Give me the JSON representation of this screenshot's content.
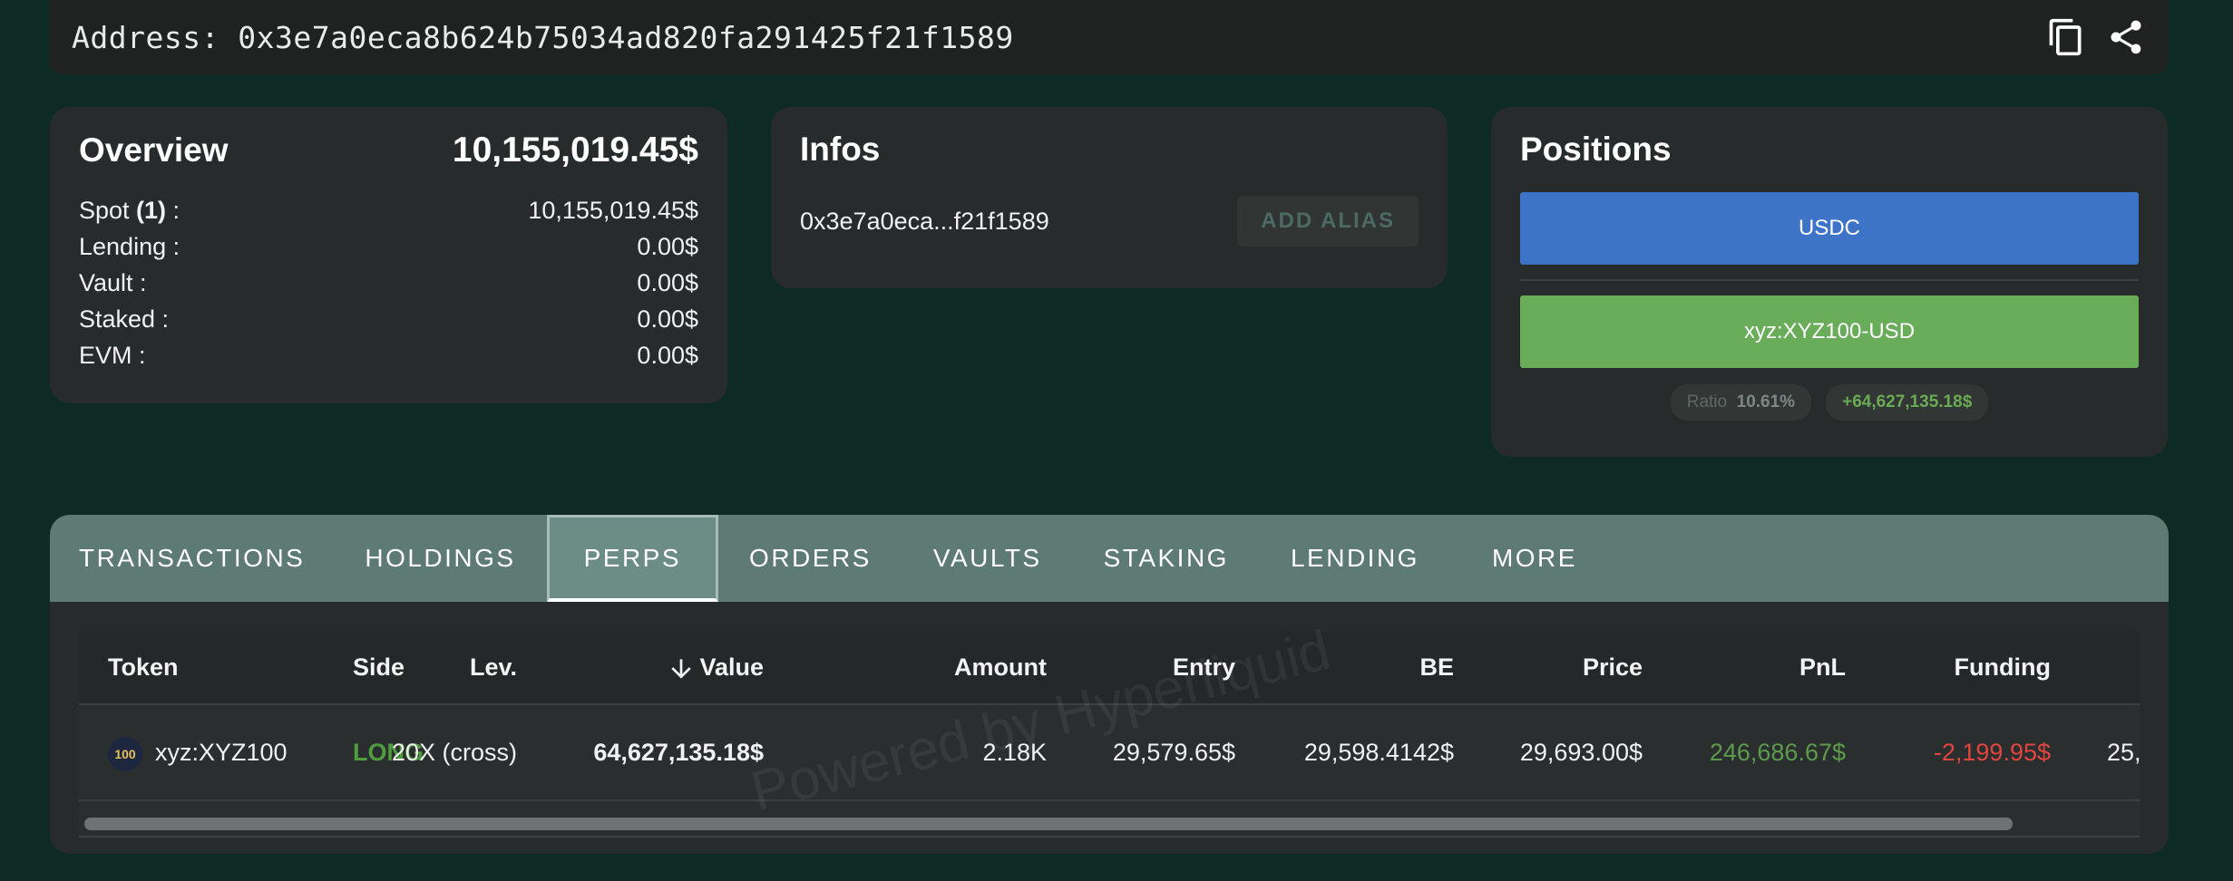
{
  "address_bar": {
    "text": "Address: 0x3e7a0eca8b624b75034ad820fa291425f21f1589",
    "copy_icon": "copy-icon",
    "share_icon": "share-icon"
  },
  "overview": {
    "title": "Overview",
    "total": "10,155,019.45$",
    "rows": [
      {
        "label": "Spot ",
        "count": "(1)",
        "suffix": " :",
        "value": "10,155,019.45$"
      },
      {
        "label": "Lending :",
        "value": "0.00$"
      },
      {
        "label": "Vault :",
        "value": "0.00$"
      },
      {
        "label": "Staked :",
        "value": "0.00$"
      },
      {
        "label": "EVM :",
        "value": "0.00$"
      }
    ]
  },
  "infos": {
    "title": "Infos",
    "short_address": "0x3e7a0eca...f21f1589",
    "alias_button": "ADD ALIAS"
  },
  "positions": {
    "title": "Positions",
    "bars": [
      "USDC",
      "xyz:XYZ100-USD"
    ],
    "ratio_label": "Ratio",
    "ratio_value": "10.61%",
    "pnl_chip": "+64,627,135.18$",
    "colors": {
      "usdc": "#3d74c8",
      "xyz": "#69ad5b"
    }
  },
  "tabs": [
    "TRANSACTIONS",
    "HOLDINGS",
    "PERPS",
    "ORDERS",
    "VAULTS",
    "STAKING",
    "LENDING",
    "MORE"
  ],
  "active_tab": "PERPS",
  "table": {
    "headers": [
      "Token",
      "Side",
      "Lev.",
      "Value",
      "Amount",
      "Entry",
      "BE",
      "Price",
      "PnL",
      "Funding"
    ],
    "sort_icon": "arrow-down-icon",
    "rows": [
      {
        "token_logo_text": "100",
        "token": "xyz:XYZ100",
        "side": "LONG",
        "lev": "20X (cross)",
        "value": "64,627,135.18$",
        "amount": "2.18K",
        "entry": "29,579.65$",
        "be": "29,598.4142$",
        "price": "29,693.00$",
        "pnl": "246,686.67$",
        "funding": "-2,199.95$",
        "overflow": "25,"
      }
    ]
  },
  "watermark": "Powered by Hyperliquid",
  "colors": {
    "background": "#0d2a24",
    "positive": "#6aaa55",
    "negative": "#e0453f",
    "long": "#4f9e3e"
  }
}
